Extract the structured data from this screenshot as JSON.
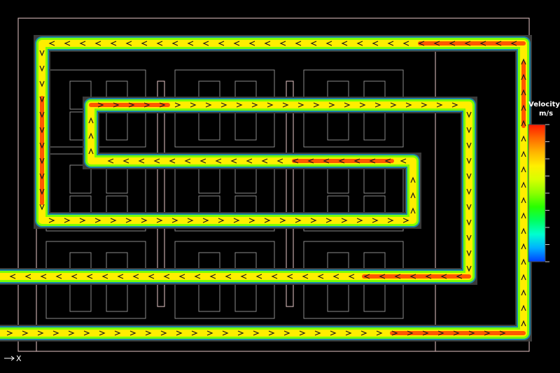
{
  "legend": {
    "title": "Velocity",
    "unit": "m/s",
    "colors": [
      "#ff1a00",
      "#ff6a00",
      "#ffb400",
      "#ffee00",
      "#d8ff00",
      "#8cff00",
      "#28ff00",
      "#00ff60",
      "#00ffd0",
      "#00b0ff",
      "#0040ff"
    ]
  },
  "axis": {
    "x_label": "X"
  },
  "palette": {
    "background": "#000000",
    "geometry_line": "#e8c8c8",
    "grid_line": "#9a9a9a",
    "flow_core": "#ffee00",
    "flow_fast": "#ff3c00",
    "flow_mid": "#7cff00",
    "flow_slow": "#00c8ff"
  }
}
